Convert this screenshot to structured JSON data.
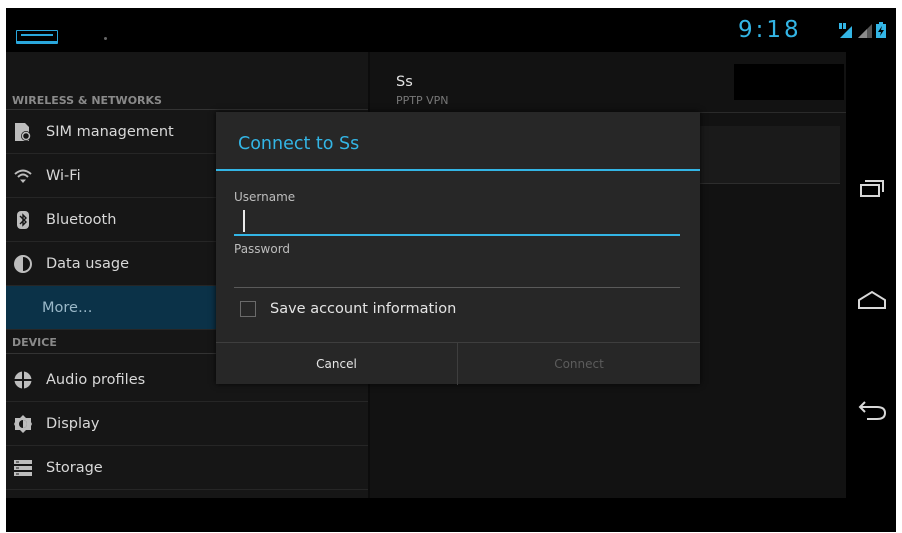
{
  "status_bar": {
    "time": "9:18",
    "colors": {
      "accent": "#33b5e5"
    },
    "icons": [
      "app-notification-icon",
      "data-activity-icon",
      "signal-icon",
      "battery-charging-icon"
    ]
  },
  "sidebar": {
    "section_wireless": "WIRELESS & NETWORKS",
    "section_device": "DEVICE",
    "items": [
      {
        "label": "SIM management",
        "icon": "sim-management-icon"
      },
      {
        "label": "Wi-Fi",
        "icon": "wifi-icon"
      },
      {
        "label": "Bluetooth",
        "icon": "bluetooth-icon"
      },
      {
        "label": "Data usage",
        "icon": "data-usage-icon"
      },
      {
        "label": "More…",
        "icon": "",
        "selected": true
      },
      {
        "label": "Audio profiles",
        "icon": "audio-profiles-icon"
      },
      {
        "label": "Display",
        "icon": "display-icon"
      },
      {
        "label": "Storage",
        "icon": "storage-icon"
      }
    ]
  },
  "vpn": {
    "name": "Ss",
    "type": "PPTP VPN"
  },
  "dialog": {
    "title": "Connect to Ss",
    "username_label": "Username",
    "username_value": "",
    "password_label": "Password",
    "password_value": "",
    "save_label": "Save account information",
    "save_checked": false,
    "cancel_label": "Cancel",
    "connect_label": "Connect"
  },
  "nav_bar": {
    "icons": [
      "recent-apps-icon",
      "home-icon",
      "back-icon"
    ]
  }
}
